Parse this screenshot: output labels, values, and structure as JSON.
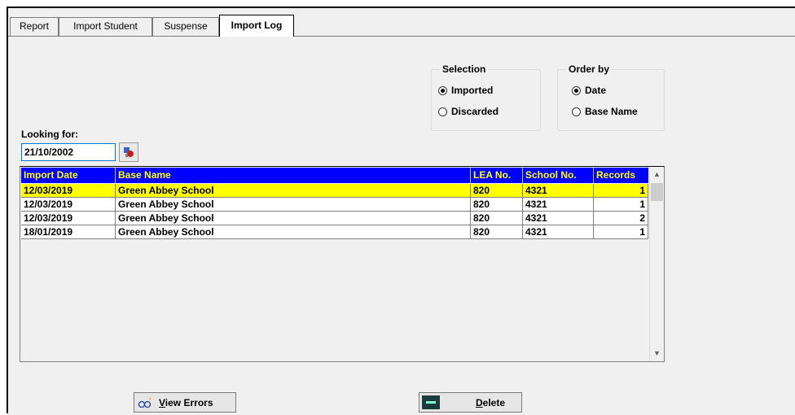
{
  "tabs": [
    {
      "label": "Report"
    },
    {
      "label": "Import Student"
    },
    {
      "label": "Suspense"
    },
    {
      "label": "Import Log",
      "active": true
    }
  ],
  "selection": {
    "title": "Selection",
    "options": [
      {
        "label": "Imported",
        "checked": true
      },
      {
        "label": "Discarded",
        "checked": false
      }
    ]
  },
  "order_by": {
    "title": "Order by",
    "options": [
      {
        "label": "Date",
        "checked": true
      },
      {
        "label": "Base Name",
        "checked": false
      }
    ]
  },
  "looking_for": {
    "label": "Looking for:",
    "value": "21/10/2002"
  },
  "grid": {
    "columns": [
      "Import Date",
      "Base Name",
      "LEA No.",
      "School No.",
      "Records"
    ],
    "rows": [
      {
        "import_date": "12/03/2019",
        "base_name": "Green Abbey School",
        "lea_no": "820",
        "school_no": "4321",
        "records": "1",
        "selected": true
      },
      {
        "import_date": "12/03/2019",
        "base_name": "Green Abbey School",
        "lea_no": "820",
        "school_no": "4321",
        "records": "1"
      },
      {
        "import_date": "12/03/2019",
        "base_name": "Green Abbey School",
        "lea_no": "820",
        "school_no": "4321",
        "records": "2"
      },
      {
        "import_date": "18/01/2019",
        "base_name": "Green Abbey School",
        "lea_no": "820",
        "school_no": "4321",
        "records": "1"
      }
    ]
  },
  "buttons": {
    "view_errors": {
      "accel": "V",
      "rest": "iew Errors",
      "icon": "glasses-icon"
    },
    "delete": {
      "accel": "D",
      "rest": "elete",
      "icon": "minus-icon"
    }
  },
  "colors": {
    "header_bg": "#0000ff",
    "header_text": "#ffff00",
    "selected_row": "#ffff00"
  }
}
